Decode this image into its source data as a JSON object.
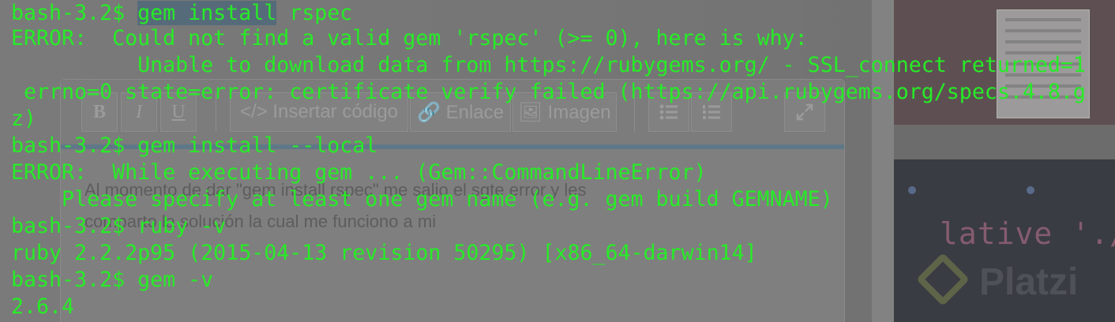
{
  "terminal": {
    "lines": [
      "bash-3.2$ gem install rspec",
      "ERROR:  Could not find a valid gem 'rspec' (>= 0), here is why:",
      "          Unable to download data from https://rubygems.org/ - SSL_connect returned=1",
      " errno=0 state=error: certificate verify failed (https://api.rubygems.org/specs.4.8.g",
      "z)",
      "bash-3.2$ gem install --local",
      "ERROR:  While executing gem ... (Gem::CommandLineError)",
      "    Please specify at least one gem name (e.g. gem build GEMNAME)",
      "bash-3.2$ ruby -v",
      "ruby 2.2.2p95 (2015-04-13 revision 50295) [x86_64-darwin14]",
      "bash-3.2$ gem -v",
      "2.6.4"
    ],
    "text_color": "#27ec27"
  },
  "editor": {
    "toolbar": {
      "bold_label": "B",
      "italic_label": "I",
      "underline_label": "U",
      "code_label": "</> Insertar código",
      "link_label": "🔗 Enlace",
      "image_label": "🖼 Imagen",
      "bullet_list_icon": "bullet-list-icon",
      "numbered_list_icon": "numbered-list-icon",
      "fullscreen_icon": "expand-icon"
    },
    "body_line_1": "Al momento de dar \"gem install rspec\" me salio el sgte error y les",
    "body_line_2": "comparto la solución la cual me funciono a mi"
  },
  "background_panel": {
    "code_snippet": "lative './",
    "brand_name": "Platzi"
  }
}
